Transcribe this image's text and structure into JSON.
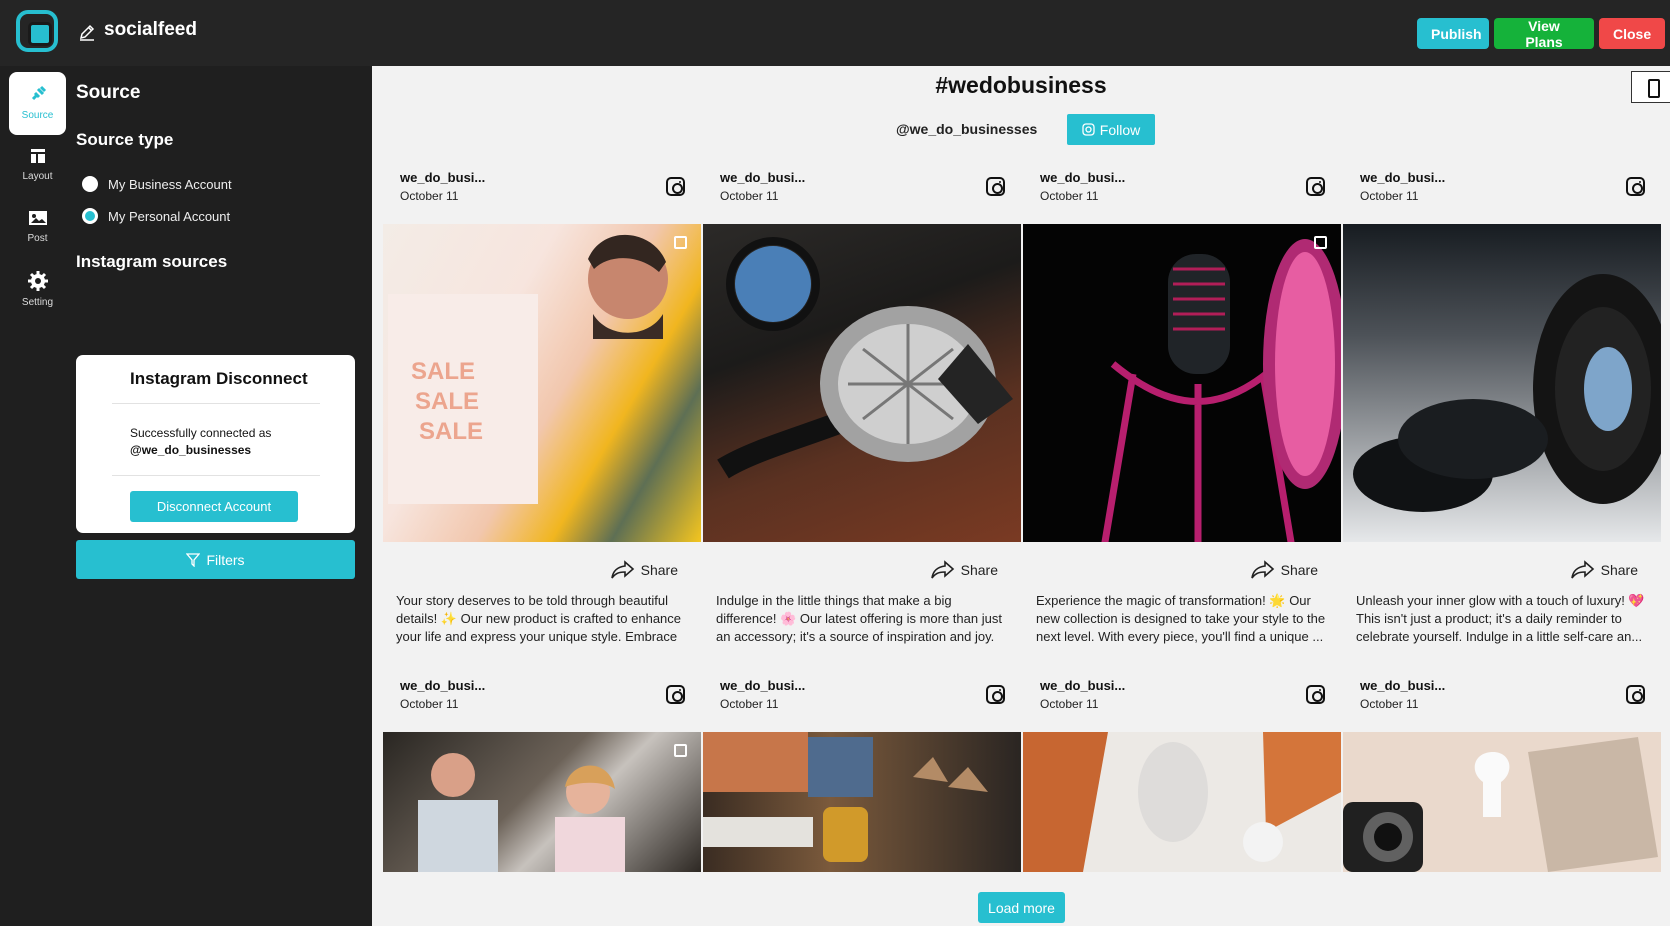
{
  "header": {
    "app_name": "socialfeed",
    "publish": "Publish",
    "view_plans": "View Plans",
    "close": "Close"
  },
  "rail": {
    "items": [
      {
        "label": "Source"
      },
      {
        "label": "Layout"
      },
      {
        "label": "Post"
      },
      {
        "label": "Setting"
      }
    ]
  },
  "panel": {
    "title": "Source",
    "source_type": "Source type",
    "options": [
      {
        "label": "My Business Account",
        "selected": false
      },
      {
        "label": "My Personal Account",
        "selected": true
      }
    ],
    "instagram_sources": "Instagram sources",
    "card": {
      "title": "Instagram Disconnect",
      "connected_text": "Successfully connected as",
      "handle": "@we_do_businesses",
      "button": "Disconnect Account"
    },
    "filters": "Filters"
  },
  "feed": {
    "title": "#wedobusiness",
    "handle": "@we_do_businesses",
    "follow": "Follow",
    "posts": [
      {
        "user": "we_do_busi...",
        "date": "October 11",
        "share": "Share",
        "caption": "Your story deserves to be told through beautiful details! ✨ Our new product is crafted to enhance your life and express your unique style. Embrace t..."
      },
      {
        "user": "we_do_busi...",
        "date": "October 11",
        "share": "Share",
        "caption": "Indulge in the little things that make a big difference! 🌸 Our latest offering is more than just an accessory; it's a source of inspiration and joy. Let it b..."
      },
      {
        "user": "we_do_busi...",
        "date": "October 11",
        "share": "Share",
        "caption": "Experience the magic of transformation! 🌟 Our new collection is designed to take your style to the next level. With every piece, you'll find a unique ..."
      },
      {
        "user": "we_do_busi...",
        "date": "October 11",
        "share": "Share",
        "caption": "Unleash your inner glow with a touch of luxury! 💖 This isn't just a product; it's a daily reminder to celebrate yourself. Indulge in a little self-care an..."
      },
      {
        "user": "we_do_busi...",
        "date": "October 11"
      },
      {
        "user": "we_do_busi...",
        "date": "October 11"
      },
      {
        "user": "we_do_busi...",
        "date": "October 11"
      },
      {
        "user": "we_do_busi...",
        "date": "October 11"
      }
    ],
    "load_more": "Load more"
  },
  "colors": {
    "accent": "#27bfd0",
    "topbar": "#252525",
    "sidebar": "#1f1f1f",
    "publish": "#27bfd0",
    "plans": "#15b23a",
    "close": "#f04848"
  }
}
